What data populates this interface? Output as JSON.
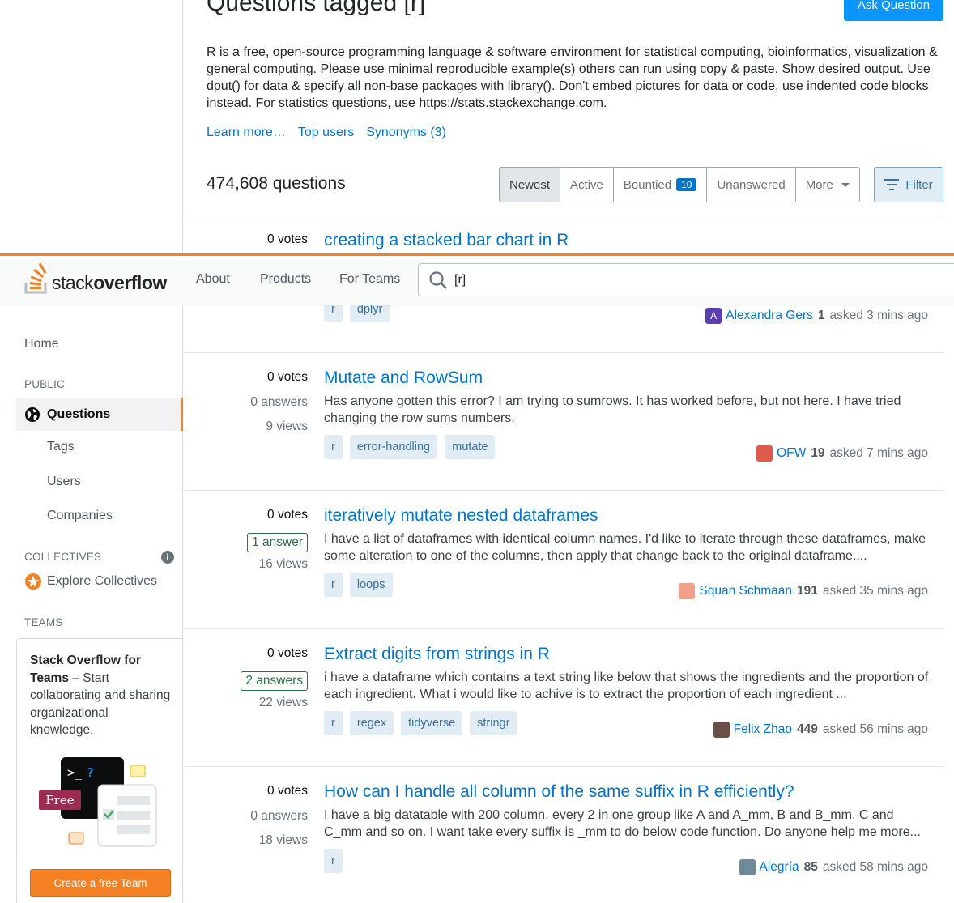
{
  "header": {
    "logo_prefix": "stack",
    "logo_bold": "overflow",
    "nav": [
      "About",
      "Products",
      "For Teams"
    ],
    "search_value": "[r]"
  },
  "sidebar": {
    "home": "Home",
    "public_label": "PUBLIC",
    "questions": "Questions",
    "tags": "Tags",
    "users": "Users",
    "companies": "Companies",
    "collectives_label": "COLLECTIVES",
    "explore_collectives": "Explore Collectives",
    "teams_label": "TEAMS",
    "teams_title": "Stack Overflow for Teams",
    "teams_body": " – Start collaborating and sharing organizational knowledge.",
    "free_badge": "Free",
    "create_team": "Create a free Team"
  },
  "main": {
    "title": "Questions tagged [r]",
    "ask_button": "Ask Question",
    "description": "R is a free, open-source programming language & software environment for statistical computing, bioinformatics, visualization & general computing. Please use minimal reproducible example(s) others can run using copy & paste. Show desired output. Use dput() for data & specify all non-base packages with library(). Don't embed pictures for data or code, use indented code blocks instead. For statistics questions, use https://stats.stackexchange.com.",
    "links": [
      "Learn more…",
      "Top users",
      "Synonyms (3)"
    ],
    "question_count": "474,608 questions",
    "filters": {
      "newest": "Newest",
      "active": "Active",
      "bountied": "Bountied",
      "bountied_count": "10",
      "unanswered": "Unanswered",
      "more": "More"
    },
    "filter_button": "Filter"
  },
  "questions": [
    {
      "votes": "0 votes",
      "answers": "",
      "views": "",
      "title": "creating a stacked bar chart in R",
      "excerpt": "",
      "tags": [
        "r",
        "dplyr"
      ],
      "user": "Alexandra Gers",
      "avatar_letter": "A",
      "rep": "1",
      "asked": "asked 3 mins ago",
      "avatar_color": "#5b3fb0"
    },
    {
      "votes": "0 votes",
      "answers": "0 answers",
      "views": "9 views",
      "title": "Mutate and RowSum",
      "excerpt": "Has anyone gotten this error? I am trying to sumrows. It has worked before, but not here. I have tried changing the row sums numbers.",
      "tags": [
        "r",
        "error-handling",
        "mutate"
      ],
      "user": "OFW",
      "avatar_letter": "",
      "rep": "19",
      "asked": "asked 7 mins ago",
      "avatar_color": "#e0594a"
    },
    {
      "votes": "0 votes",
      "answers": "1 answer",
      "views": "16 views",
      "title": "iteratively mutate nested dataframes",
      "excerpt": "I have a list of dataframes with identical column names. I'd like to iterate through these dataframes, make some alteration to one of the columns, then apply that change back to the original dataframe....",
      "tags": [
        "r",
        "loops"
      ],
      "user": "Squan Schmaan",
      "avatar_letter": "",
      "rep": "191",
      "asked": "asked 35 mins ago",
      "avatar_color": "#f0a088"
    },
    {
      "votes": "0 votes",
      "answers": "2 answers",
      "views": "22 views",
      "title": "Extract digits from strings in R",
      "excerpt": "i have a dataframe which contains a text string like below that shows the ingredients and the propor­tion of each ingredient. What i would like to achive is to extract the proportion of each ingredient ...",
      "tags": [
        "r",
        "regex",
        "tidyverse",
        "stringr"
      ],
      "user": "Felix Zhao",
      "avatar_letter": "",
      "rep": "449",
      "asked": "asked 56 mins ago",
      "avatar_color": "#6b5048"
    },
    {
      "votes": "0 votes",
      "answers": "0 answers",
      "views": "18 views",
      "title": "How can I handle all column of the same suffix in R efficiently?",
      "excerpt": "I have a big datatable with 200 column, every 2 in one group like A and A_mm, B and B_mm, C and C_mm and so on. I want take every suffix is _mm to do below code function. Do anyone help me more...",
      "tags": [
        "r"
      ],
      "user": "Alegría",
      "avatar_letter": "",
      "rep": "85",
      "asked": "asked 58 mins ago",
      "avatar_color": "#6e8a9a"
    }
  ]
}
